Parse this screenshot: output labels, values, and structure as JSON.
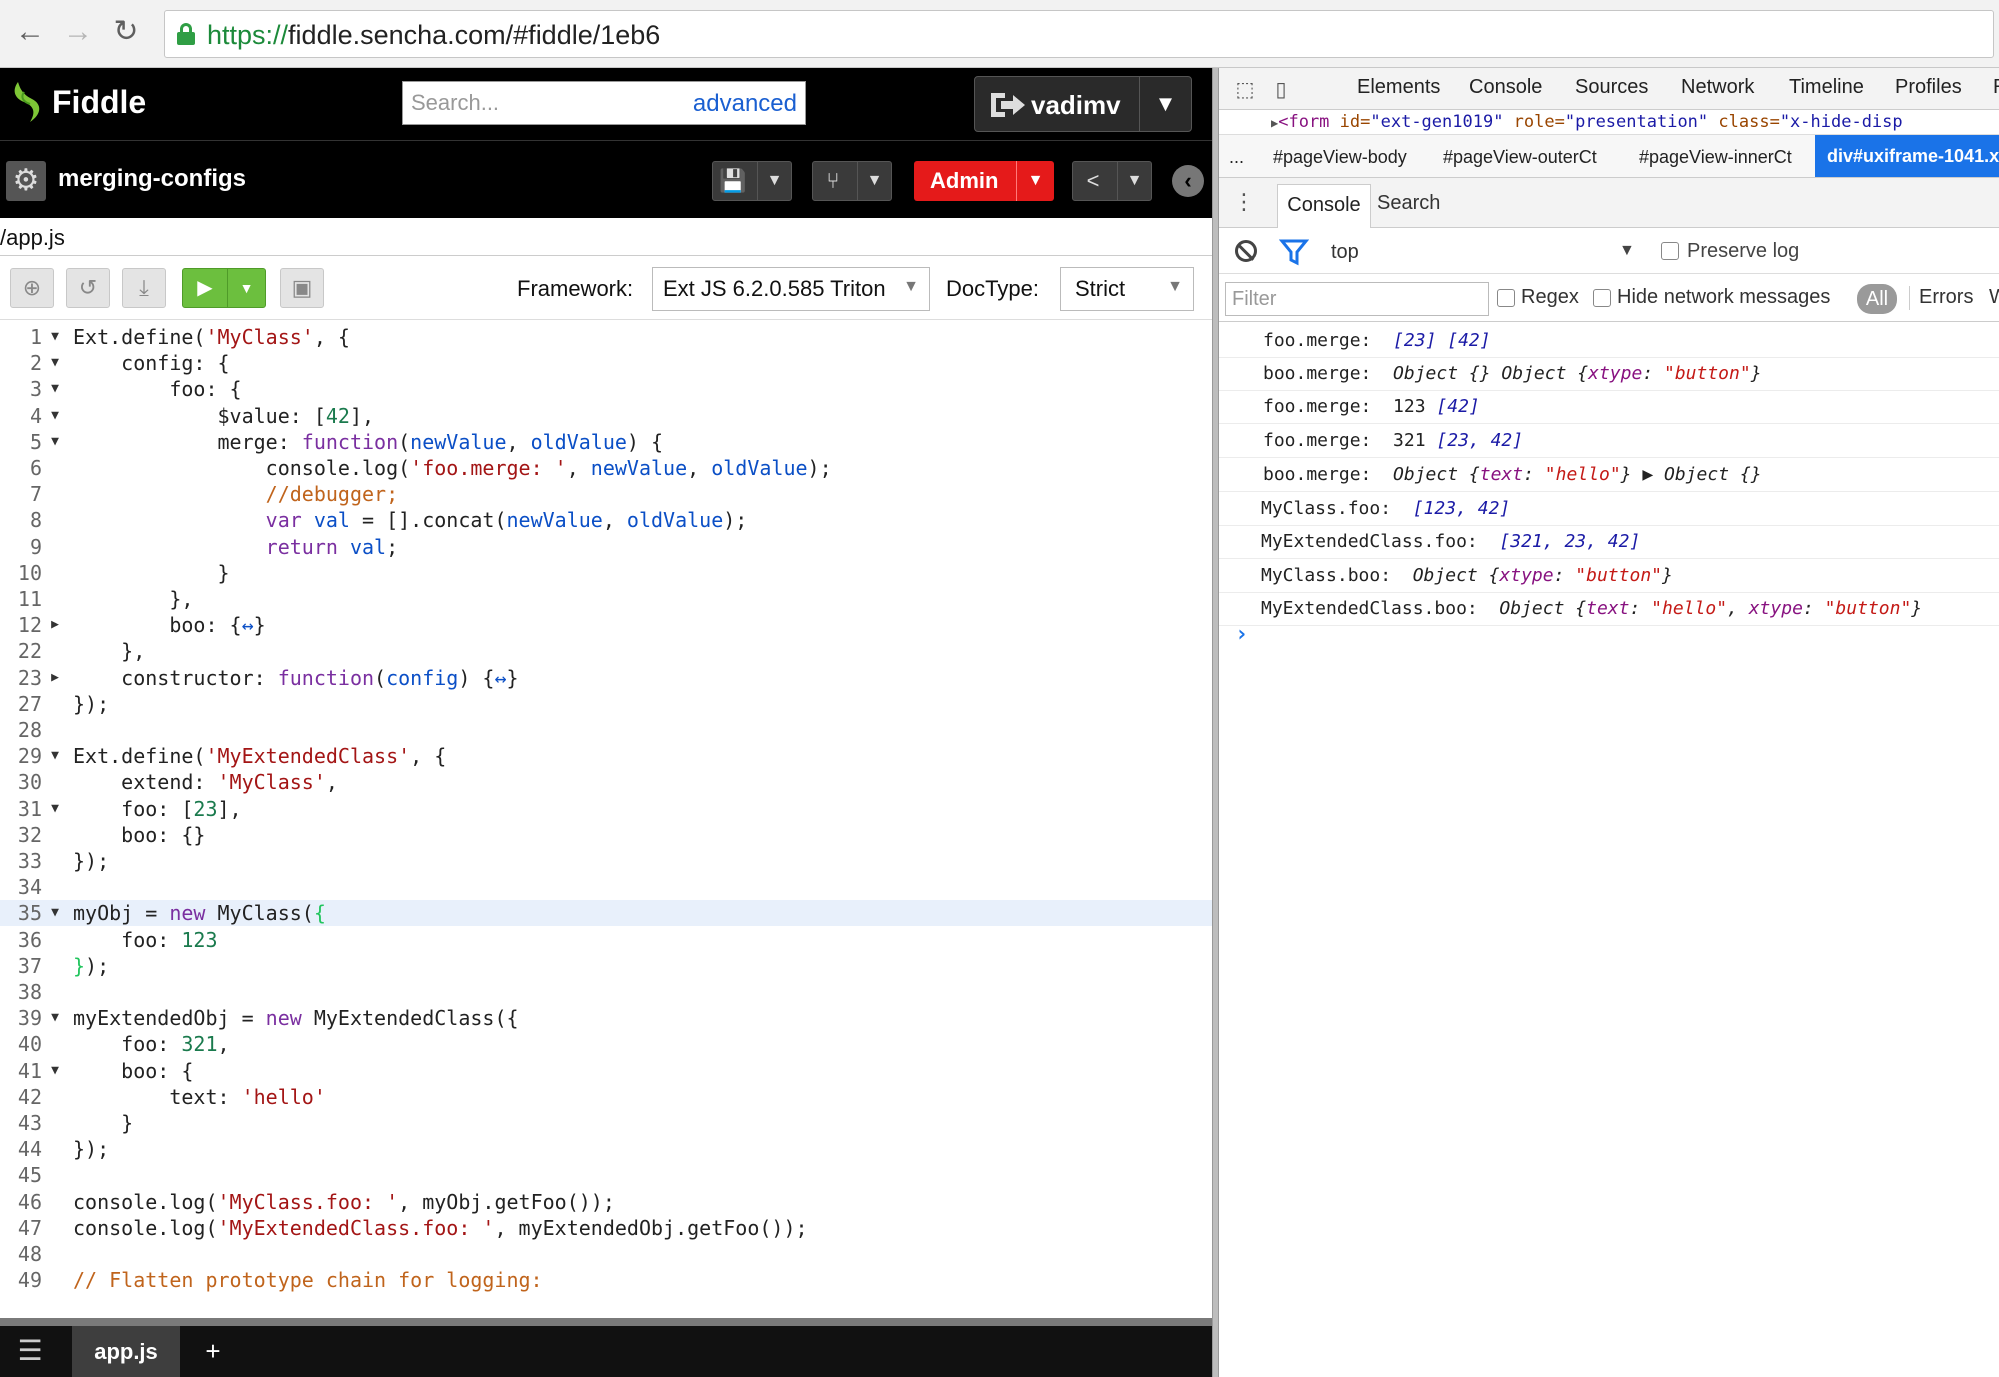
{
  "browser": {
    "url_scheme": "https://",
    "url_rest": "fiddle.sencha.com/#fiddle/1eb6",
    "back_glyph": "←",
    "forward_glyph": "→",
    "reload_glyph": "↻"
  },
  "fiddle_header": {
    "logo_text": "Fiddle",
    "search_placeholder": "Search...",
    "advanced_link": "advanced",
    "username": "vadimv"
  },
  "fiddle_bar": {
    "fiddle_name": "merging-configs",
    "admin_label": "Admin"
  },
  "file_path": "/app.js",
  "toolbar": {
    "framework_label": "Framework:",
    "framework_value": "Ext JS 6.2.0.585 Triton",
    "doctype_label": "DocType:",
    "doctype_value": "Strict"
  },
  "code_lines": [
    {
      "n": "1",
      "fold": "open"
    },
    {
      "n": "2",
      "fold": "open"
    },
    {
      "n": "3",
      "fold": "open"
    },
    {
      "n": "4",
      "fold": "open"
    },
    {
      "n": "5",
      "fold": "open"
    },
    {
      "n": "6",
      "fold": ""
    },
    {
      "n": "7",
      "fold": ""
    },
    {
      "n": "8",
      "fold": ""
    },
    {
      "n": "9",
      "fold": ""
    },
    {
      "n": "10",
      "fold": ""
    },
    {
      "n": "11",
      "fold": ""
    },
    {
      "n": "12",
      "fold": "closed"
    },
    {
      "n": "22",
      "fold": ""
    },
    {
      "n": "23",
      "fold": "closed"
    },
    {
      "n": "27",
      "fold": ""
    },
    {
      "n": "28",
      "fold": ""
    },
    {
      "n": "29",
      "fold": "open"
    },
    {
      "n": "30",
      "fold": ""
    },
    {
      "n": "31",
      "fold": "open"
    },
    {
      "n": "32",
      "fold": ""
    },
    {
      "n": "33",
      "fold": ""
    },
    {
      "n": "34",
      "fold": ""
    },
    {
      "n": "35",
      "fold": "open"
    },
    {
      "n": "36",
      "fold": ""
    },
    {
      "n": "37",
      "fold": ""
    },
    {
      "n": "38",
      "fold": ""
    },
    {
      "n": "39",
      "fold": "open"
    },
    {
      "n": "40",
      "fold": ""
    },
    {
      "n": "41",
      "fold": "open"
    },
    {
      "n": "42",
      "fold": ""
    },
    {
      "n": "43",
      "fold": ""
    },
    {
      "n": "44",
      "fold": ""
    },
    {
      "n": "45",
      "fold": ""
    },
    {
      "n": "46",
      "fold": ""
    },
    {
      "n": "47",
      "fold": ""
    },
    {
      "n": "48",
      "fold": ""
    },
    {
      "n": "49",
      "fold": ""
    }
  ],
  "code_text": [
    [
      [
        "",
        "Ext.define("
      ],
      [
        "s",
        "'MyClass'"
      ],
      [
        "",
        ", {"
      ]
    ],
    [
      [
        "",
        "    config: {"
      ]
    ],
    [
      [
        "",
        "        foo: {"
      ]
    ],
    [
      [
        "",
        "            $value: ["
      ],
      [
        "n",
        "42"
      ],
      [
        "",
        "],"
      ]
    ],
    [
      [
        "",
        "            merge: "
      ],
      [
        "k",
        "function"
      ],
      [
        "",
        "("
      ],
      [
        "p",
        "newValue"
      ],
      [
        "",
        ", "
      ],
      [
        "p",
        "oldValue"
      ],
      [
        "",
        ") {"
      ]
    ],
    [
      [
        "",
        "                console.log("
      ],
      [
        "s",
        "'foo.merge: '"
      ],
      [
        "",
        ", "
      ],
      [
        "p",
        "newValue"
      ],
      [
        "",
        ", "
      ],
      [
        "p",
        "oldValue"
      ],
      [
        "",
        ");"
      ]
    ],
    [
      [
        "c",
        "                //debugger;"
      ]
    ],
    [
      [
        "",
        "                "
      ],
      [
        "k",
        "var"
      ],
      [
        "",
        " "
      ],
      [
        "p",
        "val"
      ],
      [
        "",
        " = [].concat("
      ],
      [
        "p",
        "newValue"
      ],
      [
        "",
        ", "
      ],
      [
        "p",
        "oldValue"
      ],
      [
        "",
        ");"
      ]
    ],
    [
      [
        "",
        "                "
      ],
      [
        "k",
        "return"
      ],
      [
        "",
        " "
      ],
      [
        "p",
        "val"
      ],
      [
        "",
        ";"
      ]
    ],
    [
      [
        "",
        "            }"
      ]
    ],
    [
      [
        "",
        "        },"
      ]
    ],
    [
      [
        "",
        "        boo: {"
      ],
      [
        "p",
        "↔"
      ],
      [
        "",
        "}"
      ]
    ],
    [
      [
        "",
        "    },"
      ]
    ],
    [
      [
        "",
        "    constructor: "
      ],
      [
        "k",
        "function"
      ],
      [
        "",
        "("
      ],
      [
        "p",
        "config"
      ],
      [
        "",
        ") {"
      ],
      [
        "p",
        "↔"
      ],
      [
        "",
        "}"
      ]
    ],
    [
      [
        "",
        "});"
      ]
    ],
    [
      [
        "",
        ""
      ]
    ],
    [
      [
        "",
        "Ext.define("
      ],
      [
        "s",
        "'MyExtendedClass'"
      ],
      [
        "",
        ", {"
      ]
    ],
    [
      [
        "",
        "    extend: "
      ],
      [
        "s",
        "'MyClass'"
      ],
      [
        "",
        ","
      ]
    ],
    [
      [
        "",
        "    foo: ["
      ],
      [
        "n",
        "23"
      ],
      [
        "",
        "],"
      ]
    ],
    [
      [
        "",
        "    boo: {}"
      ]
    ],
    [
      [
        "",
        "});"
      ]
    ],
    [
      [
        "",
        ""
      ]
    ],
    [
      [
        "",
        "myObj = "
      ],
      [
        "k",
        "new"
      ],
      [
        "",
        " MyClass("
      ],
      [
        "g",
        "{"
      ]
    ],
    [
      [
        "",
        "    foo: "
      ],
      [
        "n",
        "123"
      ]
    ],
    [
      [
        "g",
        "}"
      ],
      [
        "",
        ");"
      ]
    ],
    [
      [
        "",
        ""
      ]
    ],
    [
      [
        "",
        "myExtendedObj = "
      ],
      [
        "k",
        "new"
      ],
      [
        "",
        " MyExtendedClass({"
      ]
    ],
    [
      [
        "",
        "    foo: "
      ],
      [
        "n",
        "321"
      ],
      [
        "",
        ","
      ]
    ],
    [
      [
        "",
        "    boo: {"
      ]
    ],
    [
      [
        "",
        "        text: "
      ],
      [
        "s",
        "'hello'"
      ]
    ],
    [
      [
        "",
        "    }"
      ]
    ],
    [
      [
        "",
        "});"
      ]
    ],
    [
      [
        "",
        ""
      ]
    ],
    [
      [
        "",
        "console.log("
      ],
      [
        "s",
        "'MyClass.foo: '"
      ],
      [
        "",
        ", myObj.getFoo());"
      ]
    ],
    [
      [
        "",
        "console.log("
      ],
      [
        "s",
        "'MyExtendedClass.foo: '"
      ],
      [
        "",
        ", myExtendedObj.getFoo());"
      ]
    ],
    [
      [
        "",
        ""
      ]
    ],
    [
      [
        "c",
        "// Flatten prototype chain for logging:"
      ]
    ]
  ],
  "active_line": "35",
  "bottom_tabs": {
    "file_tab": "app.js",
    "add_tab": "+"
  },
  "devtools": {
    "tabs": [
      "Elements",
      "Console",
      "Sources",
      "Network",
      "Timeline",
      "Profiles",
      "R"
    ],
    "dom_line": {
      "tag": "<form",
      "a1": " id=",
      "v1": "\"ext-gen1019\"",
      "a2": " role=",
      "v2": "\"presentation\"",
      "a3": " class=",
      "v3": "\"x-hide-disp"
    },
    "breadcrumbs": [
      "...",
      "#pageView-body",
      "#pageView-outerCt",
      "#pageView-innerCt"
    ],
    "breadcrumb_selected": "div#uxiframe-1041.x",
    "drawer_tabs": [
      "Console",
      "Search"
    ],
    "context": "top",
    "preserve_log": "Preserve log",
    "filter_placeholder": "Filter",
    "regex": "Regex",
    "hide_network": "Hide network messages",
    "level_all": "All",
    "level_errors": "Errors",
    "level_cut": "W"
  },
  "console_entries": [
    [
      [
        "k",
        "foo.merge:  "
      ],
      [
        "v",
        "[23]"
      ],
      [
        "o",
        " "
      ],
      [
        "v",
        "[42]"
      ]
    ],
    [
      [
        "k",
        "boo.merge:  "
      ],
      [
        "o",
        "Object {} Object {"
      ],
      [
        "p",
        "xtype"
      ],
      [
        "o",
        ": "
      ],
      [
        "s",
        "\"button\""
      ],
      [
        "o",
        "}"
      ]
    ],
    [
      [
        "k",
        "foo.merge:  "
      ],
      [
        "k",
        "123 "
      ],
      [
        "v",
        "[42]"
      ]
    ],
    [
      [
        "k",
        "foo.merge:  "
      ],
      [
        "k",
        "321 "
      ],
      [
        "v",
        "[23, 42]"
      ]
    ],
    [
      [
        "k",
        "boo.merge:  "
      ],
      [
        "o",
        "Object {"
      ],
      [
        "p",
        "text"
      ],
      [
        "o",
        ": "
      ],
      [
        "s",
        "\"hello\""
      ],
      [
        "o",
        "} ▶ Object {}"
      ]
    ],
    [
      [
        "k",
        "MyClass.foo:  "
      ],
      [
        "v",
        "[123, 42]"
      ]
    ],
    [
      [
        "k",
        "MyExtendedClass.foo:  "
      ],
      [
        "v",
        "[321, 23, 42]"
      ]
    ],
    [
      [
        "k",
        "MyClass.boo:  "
      ],
      [
        "o",
        "Object {"
      ],
      [
        "p",
        "xtype"
      ],
      [
        "o",
        ": "
      ],
      [
        "s",
        "\"button\""
      ],
      [
        "o",
        "}"
      ]
    ],
    [
      [
        "k",
        "MyExtendedClass.boo:  "
      ],
      [
        "o",
        "Object {"
      ],
      [
        "p",
        "text"
      ],
      [
        "o",
        ": "
      ],
      [
        "s",
        "\"hello\""
      ],
      [
        "o",
        ", "
      ],
      [
        "p",
        "xtype"
      ],
      [
        "o",
        ": "
      ],
      [
        "s",
        "\"button\""
      ],
      [
        "o",
        "}"
      ]
    ]
  ],
  "console_prompt": "›"
}
